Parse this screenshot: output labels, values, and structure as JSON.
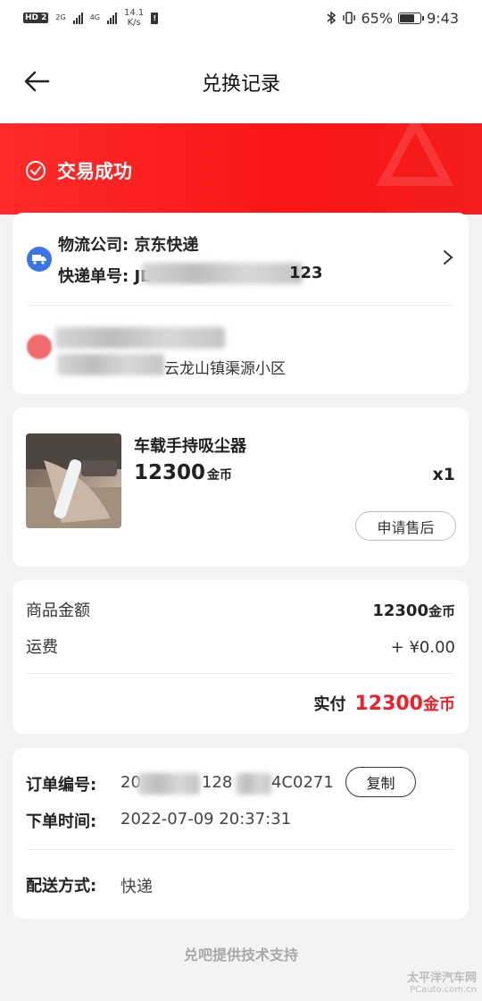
{
  "status_bar": {
    "hd_label": "HD",
    "hd_sim": "2",
    "network_1": "2G",
    "network_2": "4G",
    "speed_value": "14.1",
    "speed_unit": "K/s",
    "battery_percent": "65%",
    "battery_level": 0.65,
    "time": "9:43",
    "icons": [
      "bluetooth-icon",
      "vibrate-icon",
      "battery-icon",
      "alert-icon"
    ]
  },
  "nav": {
    "title": "兑换记录",
    "back_icon": "arrow-left-icon"
  },
  "order_status": {
    "text": "交易成功",
    "icon": "check-circle-icon",
    "color": "#f81616"
  },
  "logistics": {
    "company_line": "物流公司: 京东快递",
    "tracking_label": "快递单号:",
    "tracking_visible_prefix": "JD",
    "tracking_visible_suffix": "123",
    "icon": "truck-icon",
    "chevron": "chevron-right-icon"
  },
  "address": {
    "visible_text": "云龙山镇渠源小区"
  },
  "product": {
    "name": "车载手持吸尘器",
    "price": "12300",
    "price_unit": "金币",
    "quantity": "x1",
    "after_sale_label": "申请售后"
  },
  "cost": {
    "goods_amount_label": "商品金额",
    "goods_amount_value": "12300",
    "goods_amount_unit": "金币",
    "shipping_label": "运费",
    "shipping_value": "+ ¥0.00",
    "paid_label": "实付",
    "paid_value": "12300",
    "paid_unit": "金币",
    "accent_color": "#f01f28"
  },
  "order": {
    "number_label": "订单编号:",
    "number_visible_prefix": "20",
    "number_visible_mid": "128",
    "number_visible_suffix": "4C0271",
    "copy_label": "复制",
    "time_label": "下单时间:",
    "time_value": "2022-07-09 20:37:31",
    "delivery_label": "配送方式:",
    "delivery_value": "快递"
  },
  "footer": {
    "text": "兑吧提供技术支持"
  },
  "watermark": {
    "line1": "太平洋汽车网",
    "line2": "PCauto.com.cn"
  }
}
